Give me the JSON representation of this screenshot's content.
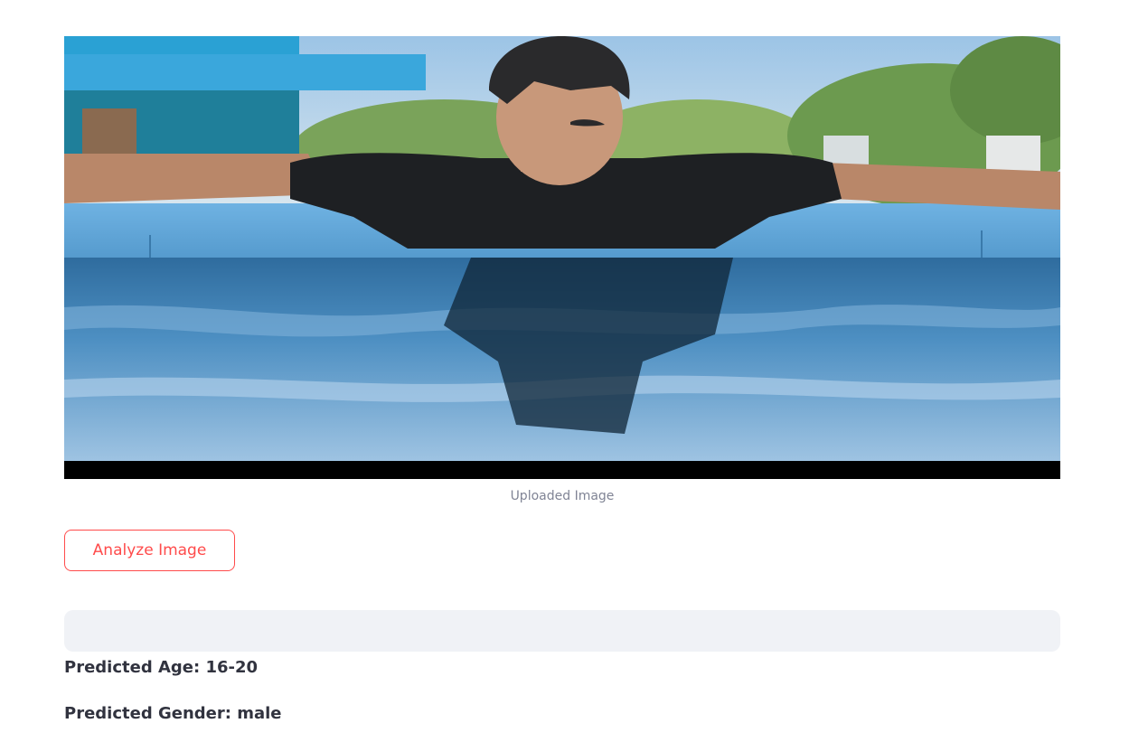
{
  "image": {
    "caption": "Uploaded Image",
    "alt": "Uploaded Image"
  },
  "actions": {
    "analyze_label": "Analyze Image"
  },
  "progress": {
    "value": 0
  },
  "results": {
    "age": "Predicted Age: 16-20",
    "gender": "Predicted Gender: male"
  },
  "colors": {
    "accent": "#ff4b4b",
    "text": "#31333f",
    "caption": "#808495",
    "progress_track": "#f0f2f6"
  }
}
